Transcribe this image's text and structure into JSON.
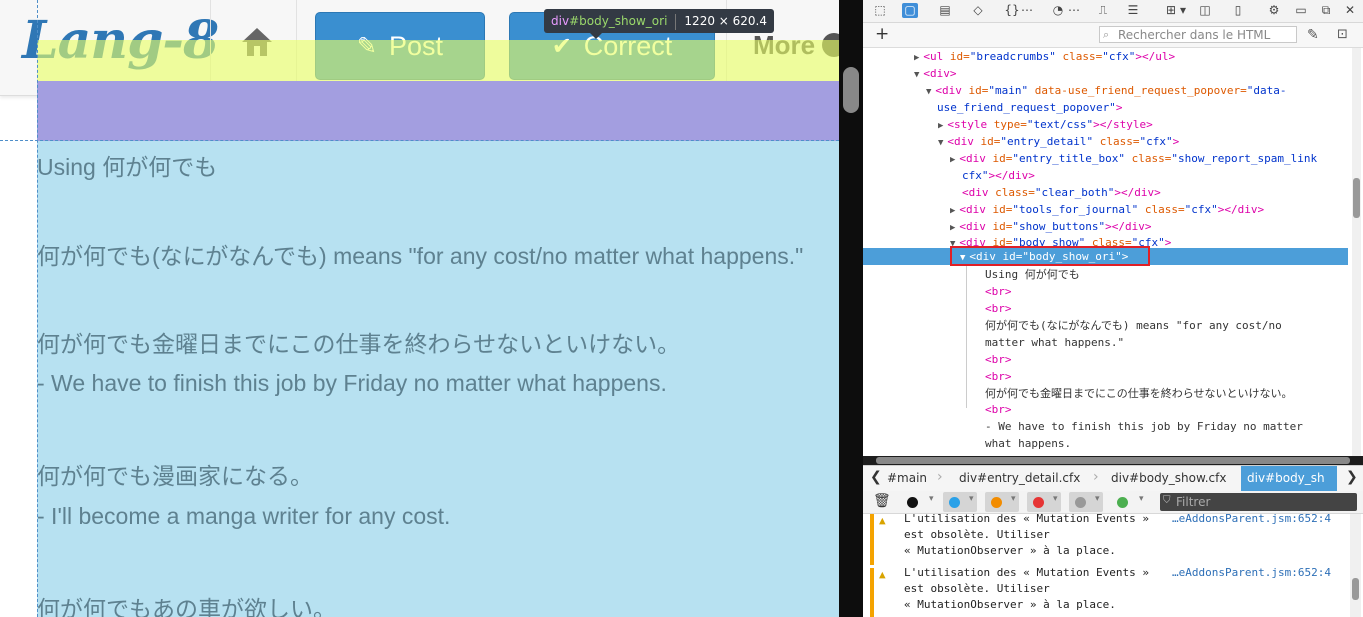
{
  "site": {
    "logo": "Lang-8",
    "post_label": "Post",
    "correct_label": "Correct",
    "more_label": "More"
  },
  "entry": {
    "lines": [
      "Using 何が何でも",
      "何が何でも(なにがなんでも) means \"for any cost/no matter what happens.\"",
      "何が何でも金曜日までにこの仕事を終わらせないといけない。",
      "- We have to finish this job by Friday no matter what happens.",
      "何が何でも漫画家になる。",
      "- I'll become a manga writer for any cost.",
      "何が何でもあの車が欲しい。"
    ]
  },
  "tooltip": {
    "tag": "div",
    "id": "#body_show_ori",
    "size": "1220 × 620.4"
  },
  "devtools": {
    "search_placeholder": "Rechercher dans le HTML",
    "markup": {
      "l1_tag": "<ul ",
      "l1_a1": "id=",
      "l1_v1": "\"breadcrumbs\"",
      "l1_a2": " class=",
      "l1_v2": "\"cfx\"",
      "l1_end": "></ul>",
      "l2": "<div>",
      "l3_tag": "<div ",
      "l3_a1": "id=",
      "l3_v1": "\"main\"",
      "l3_a2": " data-use_friend_request_popover=",
      "l3_v2": "\"data-",
      "l4_v": "use_friend_request_popover\"",
      "l4_end": ">",
      "l5_tag": "<style ",
      "l5_a": "type=",
      "l5_v": "\"text/css\"",
      "l5_end": "></style>",
      "l6_tag": "<div ",
      "l6_a1": "id=",
      "l6_v1": "\"entry_detail\"",
      "l6_a2": " class=",
      "l6_v2": "\"cfx\"",
      "l6_end": ">",
      "l7_tag": "<div ",
      "l7_a1": "id=",
      "l7_v1": "\"entry_title_box\"",
      "l7_a2": " class=",
      "l7_v2": "\"show_report_spam_link",
      "l8_v": "cfx\"",
      "l8_end": "></div>",
      "l9_tag": "<div ",
      "l9_a": "class=",
      "l9_v": "\"clear_both\"",
      "l9_end": "></div>",
      "l10_tag": "<div ",
      "l10_a1": "id=",
      "l10_v1": "\"tools_for_journal\"",
      "l10_a2": " class=",
      "l10_v2": "\"cfx\"",
      "l10_end": "></div>",
      "l11_tag": "<div ",
      "l11_a": "id=",
      "l11_v": "\"show_buttons\"",
      "l11_end": "></div>",
      "l12_tag": "<div ",
      "l12_a1": "id=",
      "l12_v1": "\"body_show\"",
      "l12_a2": " class=",
      "l12_v2": "\"cfx\"",
      "l12_end": ">",
      "selected": "<div id=\"body_show_ori\">",
      "t1": "Using 何が何でも",
      "br": "<br>",
      "t2a": "何が何でも(なにがなんでも) means \"for any cost/no",
      "t2b": "matter what happens.\"",
      "t3": "何が何でも金曜日までにこの仕事を終わらせないといけない。",
      "t4a": "- We have to finish this job by Friday no matter",
      "t4b": "what happens."
    },
    "breadcrumbs": [
      "#main",
      "div#entry_detail.cfx",
      "div#body_show.cfx",
      "div#body_sh"
    ],
    "filter_placeholder": "Filtrer",
    "console": [
      {
        "line1": "L'utilisation des « Mutation Events »",
        "src": "…eAddonsParent.jsm:652:4",
        "line2": "est obsolète. Utiliser",
        "line3": "« MutationObserver » à la place."
      },
      {
        "line1": "L'utilisation des « Mutation Events »",
        "src": "…eAddonsParent.jsm:652:4",
        "line2": "est obsolète. Utiliser",
        "line3": "« MutationObserver » à la place."
      }
    ]
  },
  "colors": {
    "margin_highlight": "#e9ff64",
    "padding_highlight": "#a39ee0",
    "content_highlight": "#b7e1f1",
    "selection": "#4c9ed9",
    "warning": "#f4a300"
  }
}
